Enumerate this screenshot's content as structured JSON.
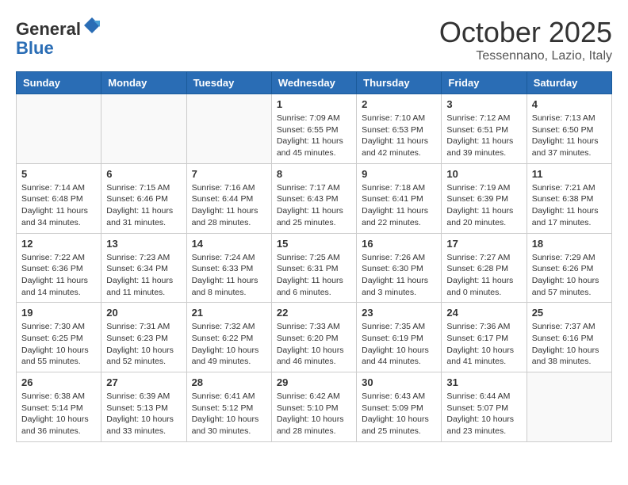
{
  "header": {
    "logo_line1": "General",
    "logo_line2": "Blue",
    "month": "October 2025",
    "location": "Tessennano, Lazio, Italy"
  },
  "weekdays": [
    "Sunday",
    "Monday",
    "Tuesday",
    "Wednesday",
    "Thursday",
    "Friday",
    "Saturday"
  ],
  "weeks": [
    [
      {
        "day": "",
        "info": ""
      },
      {
        "day": "",
        "info": ""
      },
      {
        "day": "",
        "info": ""
      },
      {
        "day": "1",
        "info": "Sunrise: 7:09 AM\nSunset: 6:55 PM\nDaylight: 11 hours\nand 45 minutes."
      },
      {
        "day": "2",
        "info": "Sunrise: 7:10 AM\nSunset: 6:53 PM\nDaylight: 11 hours\nand 42 minutes."
      },
      {
        "day": "3",
        "info": "Sunrise: 7:12 AM\nSunset: 6:51 PM\nDaylight: 11 hours\nand 39 minutes."
      },
      {
        "day": "4",
        "info": "Sunrise: 7:13 AM\nSunset: 6:50 PM\nDaylight: 11 hours\nand 37 minutes."
      }
    ],
    [
      {
        "day": "5",
        "info": "Sunrise: 7:14 AM\nSunset: 6:48 PM\nDaylight: 11 hours\nand 34 minutes."
      },
      {
        "day": "6",
        "info": "Sunrise: 7:15 AM\nSunset: 6:46 PM\nDaylight: 11 hours\nand 31 minutes."
      },
      {
        "day": "7",
        "info": "Sunrise: 7:16 AM\nSunset: 6:44 PM\nDaylight: 11 hours\nand 28 minutes."
      },
      {
        "day": "8",
        "info": "Sunrise: 7:17 AM\nSunset: 6:43 PM\nDaylight: 11 hours\nand 25 minutes."
      },
      {
        "day": "9",
        "info": "Sunrise: 7:18 AM\nSunset: 6:41 PM\nDaylight: 11 hours\nand 22 minutes."
      },
      {
        "day": "10",
        "info": "Sunrise: 7:19 AM\nSunset: 6:39 PM\nDaylight: 11 hours\nand 20 minutes."
      },
      {
        "day": "11",
        "info": "Sunrise: 7:21 AM\nSunset: 6:38 PM\nDaylight: 11 hours\nand 17 minutes."
      }
    ],
    [
      {
        "day": "12",
        "info": "Sunrise: 7:22 AM\nSunset: 6:36 PM\nDaylight: 11 hours\nand 14 minutes."
      },
      {
        "day": "13",
        "info": "Sunrise: 7:23 AM\nSunset: 6:34 PM\nDaylight: 11 hours\nand 11 minutes."
      },
      {
        "day": "14",
        "info": "Sunrise: 7:24 AM\nSunset: 6:33 PM\nDaylight: 11 hours\nand 8 minutes."
      },
      {
        "day": "15",
        "info": "Sunrise: 7:25 AM\nSunset: 6:31 PM\nDaylight: 11 hours\nand 6 minutes."
      },
      {
        "day": "16",
        "info": "Sunrise: 7:26 AM\nSunset: 6:30 PM\nDaylight: 11 hours\nand 3 minutes."
      },
      {
        "day": "17",
        "info": "Sunrise: 7:27 AM\nSunset: 6:28 PM\nDaylight: 11 hours\nand 0 minutes."
      },
      {
        "day": "18",
        "info": "Sunrise: 7:29 AM\nSunset: 6:26 PM\nDaylight: 10 hours\nand 57 minutes."
      }
    ],
    [
      {
        "day": "19",
        "info": "Sunrise: 7:30 AM\nSunset: 6:25 PM\nDaylight: 10 hours\nand 55 minutes."
      },
      {
        "day": "20",
        "info": "Sunrise: 7:31 AM\nSunset: 6:23 PM\nDaylight: 10 hours\nand 52 minutes."
      },
      {
        "day": "21",
        "info": "Sunrise: 7:32 AM\nSunset: 6:22 PM\nDaylight: 10 hours\nand 49 minutes."
      },
      {
        "day": "22",
        "info": "Sunrise: 7:33 AM\nSunset: 6:20 PM\nDaylight: 10 hours\nand 46 minutes."
      },
      {
        "day": "23",
        "info": "Sunrise: 7:35 AM\nSunset: 6:19 PM\nDaylight: 10 hours\nand 44 minutes."
      },
      {
        "day": "24",
        "info": "Sunrise: 7:36 AM\nSunset: 6:17 PM\nDaylight: 10 hours\nand 41 minutes."
      },
      {
        "day": "25",
        "info": "Sunrise: 7:37 AM\nSunset: 6:16 PM\nDaylight: 10 hours\nand 38 minutes."
      }
    ],
    [
      {
        "day": "26",
        "info": "Sunrise: 6:38 AM\nSunset: 5:14 PM\nDaylight: 10 hours\nand 36 minutes."
      },
      {
        "day": "27",
        "info": "Sunrise: 6:39 AM\nSunset: 5:13 PM\nDaylight: 10 hours\nand 33 minutes."
      },
      {
        "day": "28",
        "info": "Sunrise: 6:41 AM\nSunset: 5:12 PM\nDaylight: 10 hours\nand 30 minutes."
      },
      {
        "day": "29",
        "info": "Sunrise: 6:42 AM\nSunset: 5:10 PM\nDaylight: 10 hours\nand 28 minutes."
      },
      {
        "day": "30",
        "info": "Sunrise: 6:43 AM\nSunset: 5:09 PM\nDaylight: 10 hours\nand 25 minutes."
      },
      {
        "day": "31",
        "info": "Sunrise: 6:44 AM\nSunset: 5:07 PM\nDaylight: 10 hours\nand 23 minutes."
      },
      {
        "day": "",
        "info": ""
      }
    ]
  ]
}
